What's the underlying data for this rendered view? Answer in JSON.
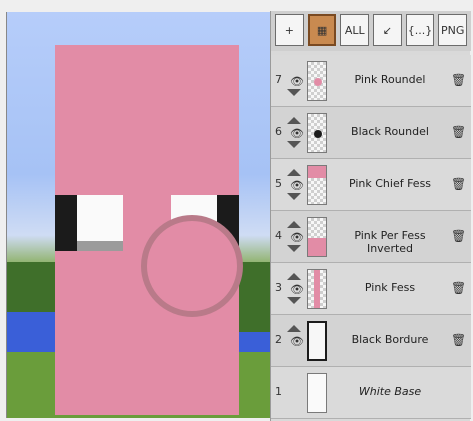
{
  "toolbar": {
    "buttons": [
      {
        "name": "add-layer",
        "icon": "banner-add-icon"
      },
      {
        "name": "loom",
        "icon": "loom-icon"
      },
      {
        "name": "all-patterns",
        "label": "ALL",
        "icon": "shield-all-icon"
      },
      {
        "name": "export-banner",
        "icon": "banner-export-icon"
      },
      {
        "name": "json",
        "label": "{...}",
        "icon": "json-icon"
      },
      {
        "name": "png",
        "label": "PNG",
        "icon": "png-icon"
      }
    ]
  },
  "layers": [
    {
      "num": "7",
      "name": "Pink Roundel",
      "thumb": "pink-roundel"
    },
    {
      "num": "6",
      "name": "Black Roundel",
      "thumb": "black-roundel"
    },
    {
      "num": "5",
      "name": "Pink Chief Fess",
      "thumb": "pink-chief"
    },
    {
      "num": "4",
      "name": "Pink Per Fess Inverted",
      "thumb": "pink-per-fess"
    },
    {
      "num": "3",
      "name": "Pink Fess",
      "thumb": "pink-fess"
    },
    {
      "num": "2",
      "name": "Black Bordure",
      "thumb": "black-bordure"
    },
    {
      "num": "1",
      "name": "White Base",
      "thumb": "white-base"
    }
  ],
  "colors": {
    "pink": "#e28ca6",
    "black": "#1b1b1b",
    "white": "#fafafa"
  }
}
